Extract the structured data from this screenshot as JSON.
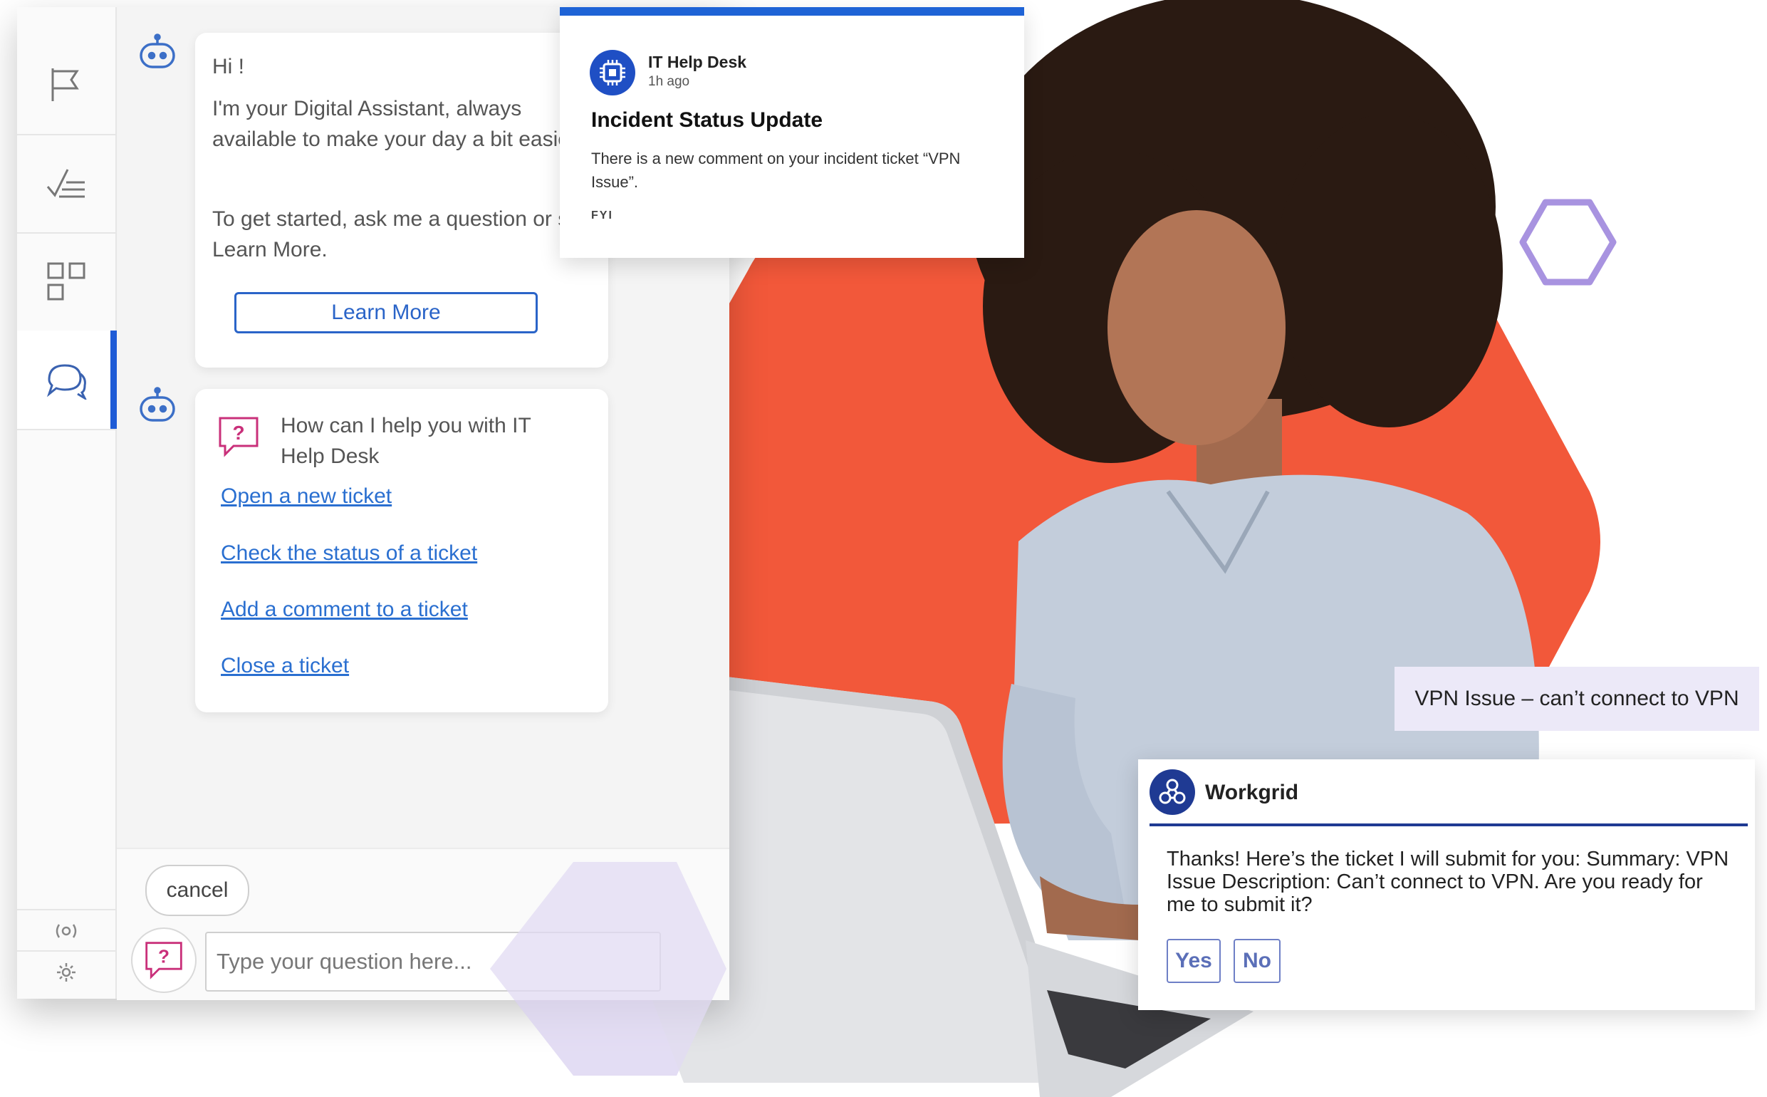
{
  "colors": {
    "accent_blue": "#1e5bd6",
    "hero_orange": "#f2583a",
    "hex_purple": "#a893e0",
    "hex_lavender": "#e6e0f4",
    "workgrid_navy": "#1f3a93"
  },
  "sidebar": {
    "items": [
      {
        "icon": "flag-icon"
      },
      {
        "icon": "checklist-icon"
      },
      {
        "icon": "apps-grid-icon"
      },
      {
        "icon": "chat-bubbles-icon",
        "active": true
      }
    ],
    "bottom": [
      {
        "icon": "radio-signal-icon"
      },
      {
        "icon": "settings-gear-icon"
      }
    ]
  },
  "chat": {
    "greeting": {
      "hi": "Hi !",
      "intro": "I'm your Digital Assistant, always available to make your day a bit easier.",
      "getting_started": "To get started, ask me a question or say Learn More.",
      "learn_more_label": "Learn More"
    },
    "help": {
      "prompt": "How can I help you with IT Help Desk",
      "options": [
        "Open a new ticket",
        "Check the status of a ticket",
        "Add a comment to a ticket",
        "Close a ticket"
      ]
    },
    "input": {
      "cancel_label": "cancel",
      "placeholder": "Type your question here..."
    }
  },
  "incident_card": {
    "source": "IT Help Desk",
    "time": "1h ago",
    "title": "Incident Status Update",
    "body": "There is a new comment on your incident ticket “VPN Issue”.",
    "tag": "FYI"
  },
  "user_message": "VPN Issue – can’t connect to VPN",
  "workgrid_card": {
    "name": "Workgrid",
    "message": "Thanks! Here’s the ticket I will submit for you: Summary: VPN Issue Description: Can’t connect to VPN. Are you ready for me to submit it?",
    "yes_label": "Yes",
    "no_label": "No"
  }
}
